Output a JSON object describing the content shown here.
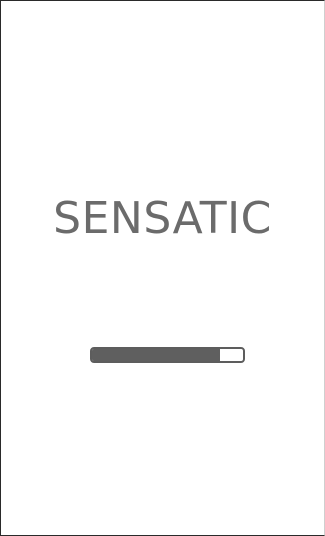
{
  "splash": {
    "title": "SENSATIC",
    "progress": 0.85
  },
  "colors": {
    "background": "#ffffff",
    "title_text": "#6b6b6b",
    "progress_fill": "#5f5f5f",
    "progress_border": "#5d5d5d"
  }
}
